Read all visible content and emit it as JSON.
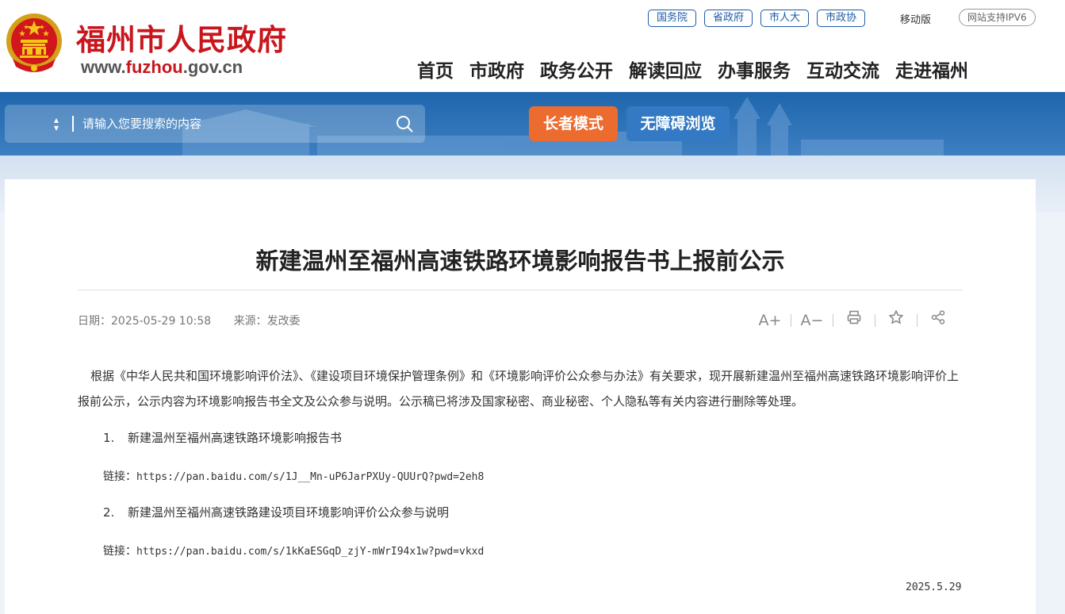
{
  "header": {
    "site_title": "福州市人民政府",
    "url_prefix": "www.",
    "url_highlight": "fuzhou",
    "url_suffix": ".gov.cn",
    "top_links": [
      "国务院",
      "省政府",
      "市人大",
      "市政协"
    ],
    "mobile_label": "移动版",
    "ipv6_label": "网站支持IPV6",
    "nav": [
      "首页",
      "市政府",
      "政务公开",
      "解读回应",
      "办事服务",
      "互动交流",
      "走进福州"
    ]
  },
  "banner": {
    "search_placeholder": "请输入您要搜索的内容",
    "elder_mode_label": "长者模式",
    "accessibility_label": "无障碍浏览"
  },
  "article": {
    "title": "新建温州至福州高速铁路环境影响报告书上报前公示",
    "date_label": "日期：2025-05-29 10:58",
    "source_label": "来源：发改委",
    "tools": {
      "font_increase": "A+",
      "font_decrease": "A−"
    },
    "paragraph": "根据《中华人民共和国环境影响评价法》、《建设项目环境保护管理条例》和《环境影响评价公众参与办法》有关要求，现开展新建温州至福州高速铁路环境影响评价上报前公示，公示内容为环境影响报告书全文及公众参与说明。公示稿已将涉及国家秘密、商业秘密、个人隐私等有关内容进行删除等处理。",
    "items": [
      {
        "num": "1.",
        "text": "新建温州至福州高速铁路环境影响报告书",
        "link_label": "链接：",
        "link_url": "https://pan.baidu.com/s/1J__Mn-uP6JarPXUy-QUUrQ?pwd=2eh8"
      },
      {
        "num": "2.",
        "text": "新建温州至福州高速铁路建设项目环境影响评价公众参与说明",
        "link_label": "链接：",
        "link_url": "https://pan.baidu.com/s/1kKaESGqD_zjY-mWrI94x1w?pwd=vkxd"
      }
    ],
    "publish_date": "2025.5.29"
  },
  "colors": {
    "brand_red": "#c8161d",
    "banner_blue": "#1e66ad",
    "elder_orange": "#ec6b2e",
    "access_blue": "#3479c3"
  },
  "icons": [
    "national-emblem-icon",
    "select-arrows-icon",
    "search-icon",
    "print-icon",
    "star-icon",
    "share-icon"
  ]
}
